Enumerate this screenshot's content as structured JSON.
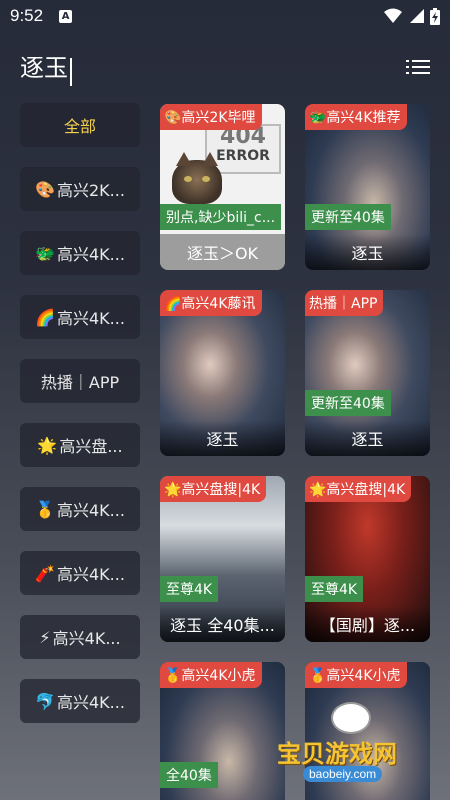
{
  "status": {
    "time": "9:52",
    "notif": "A"
  },
  "search": {
    "query": "逐玉"
  },
  "sidebar": {
    "items": [
      {
        "label": "全部",
        "emoji": ""
      },
      {
        "label": "高兴2K...",
        "emoji": "🎨"
      },
      {
        "label": "高兴4K...",
        "emoji": "🐲"
      },
      {
        "label": "高兴4K...",
        "emoji": "🌈"
      },
      {
        "label": "热播｜APP",
        "emoji": ""
      },
      {
        "label": "高兴盘...",
        "emoji": "🌟"
      },
      {
        "label": "高兴4K...",
        "emoji": "🥇"
      },
      {
        "label": "高兴4K...",
        "emoji": "🧨"
      },
      {
        "label": "高兴4K...",
        "emoji": "⚡"
      },
      {
        "label": "高兴4K...",
        "emoji": "🐬"
      }
    ]
  },
  "cards": [
    {
      "badge": "🎨高兴2K毕哩",
      "tag": "别点,缺少bili_c...",
      "title": "逐玉＞OK",
      "error": {
        "big": "404",
        "small": "ERROR"
      }
    },
    {
      "badge": "🐲高兴4K推荐",
      "tag": "更新至40集",
      "title": "逐玉"
    },
    {
      "badge": "🌈高兴4K藤讯",
      "tag": "",
      "title": "逐玉"
    },
    {
      "badge": "热播｜APP",
      "tag": "更新至40集",
      "title": "逐玉"
    },
    {
      "badge": "🌟高兴盘搜|4K",
      "tag": "至尊4K",
      "title": "逐玉 全40集..."
    },
    {
      "badge": "🌟高兴盘搜|4K",
      "tag": "至尊4K",
      "title": "【国剧】逐..."
    },
    {
      "badge": "🥇高兴4K小虎",
      "tag": "全40集",
      "title": ""
    },
    {
      "badge": "🥇高兴4K小虎",
      "tag": "",
      "title": ""
    }
  ],
  "watermark": {
    "text": "宝贝游戏网",
    "url": "baobeiy.com"
  },
  "colors": {
    "accent": "#f2d14b",
    "badge": "#e0493f",
    "tag": "#3d8f4c"
  }
}
